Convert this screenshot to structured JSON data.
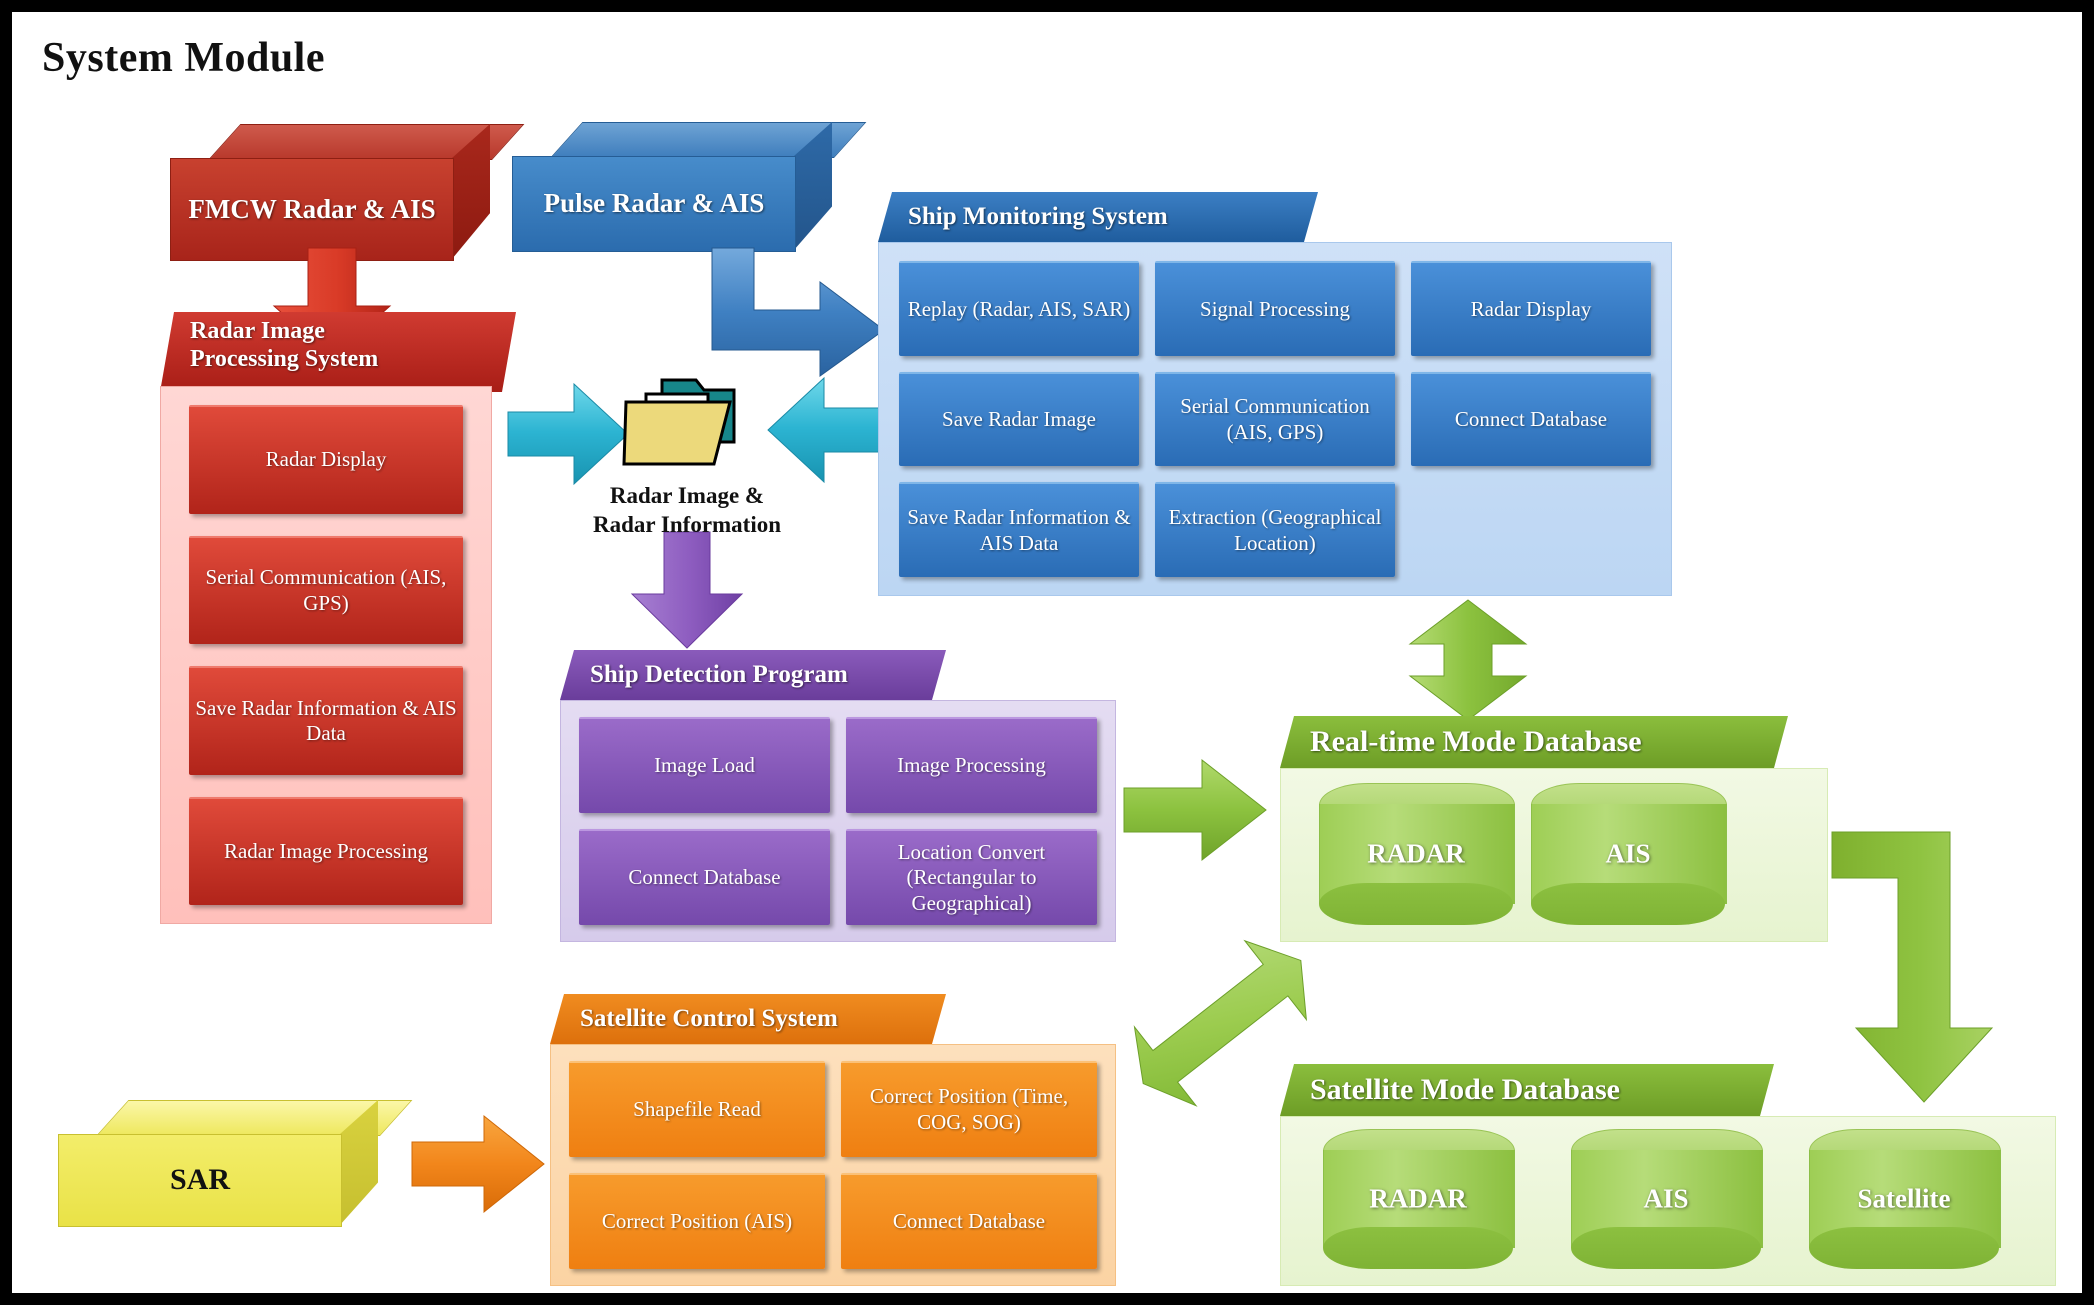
{
  "page": {
    "title": "System Module"
  },
  "sources": {
    "fmcw": {
      "label": "FMCW Radar & AIS",
      "color": "#c0392b"
    },
    "pulse": {
      "label": "Pulse Radar & AIS",
      "color": "#2e6da4"
    },
    "sar": {
      "label": "SAR",
      "color": "#e8e14a"
    }
  },
  "store": {
    "icon": "folder-icon",
    "caption_line1": "Radar Image &",
    "caption_line2": "Radar Information"
  },
  "panels": {
    "radar_image_processing": {
      "title": "Radar Image Processing System",
      "title_line1": "Radar Image",
      "title_line2": "Processing System",
      "color": "#b1241a",
      "items": [
        "Radar Display",
        "Serial Communication (AIS, GPS)",
        "Save Radar Information & AIS Data",
        "Radar Image Processing"
      ]
    },
    "ship_monitoring": {
      "title": "Ship Monitoring System",
      "color": "#2a6cb5",
      "items": [
        "Replay (Radar, AIS, SAR)",
        "Signal Processing",
        "Radar Display",
        "Save Radar Image",
        "Serial Communication (AIS, GPS)",
        "Connect Database",
        "Save Radar Information & AIS Data",
        "Extraction (Geographical Location)"
      ]
    },
    "ship_detection": {
      "title": "Ship Detection Program",
      "color": "#7549ab",
      "items": [
        "Image Load",
        "Image Processing",
        "Connect Database",
        "Location Convert (Rectangular to Geographical)"
      ]
    },
    "satellite_control": {
      "title": "Satellite Control System",
      "color": "#ef7f11",
      "items": [
        "Shapefile Read",
        "Correct Position (Time, COG, SOG)",
        "Correct Position (AIS)",
        "Connect Database"
      ]
    },
    "realtime_db": {
      "title": "Real-time  Mode Database",
      "color": "#6d9d26",
      "stores": [
        "RADAR",
        "AIS"
      ]
    },
    "satellite_db": {
      "title": "Satellite  Mode Database",
      "color": "#6d9d26",
      "stores": [
        "RADAR",
        "AIS",
        "Satellite"
      ]
    }
  },
  "arrows": {
    "fmcw_down": {
      "name": "red-down-arrow",
      "color": "#e03a2a"
    },
    "folder_in_left": {
      "name": "cyan-right-arrow",
      "color": "#2eb6d4"
    },
    "folder_in_right": {
      "name": "cyan-left-arrow",
      "color": "#2eb6d4"
    },
    "pulse_to_monitoring": {
      "name": "blue-elbow-right-arrow",
      "color": "#3d7fc0"
    },
    "folder_down": {
      "name": "purple-down-arrow",
      "color": "#9a6bc9"
    },
    "detection_to_rtdb": {
      "name": "green-right-arrow",
      "color": "#8cc23f"
    },
    "monitoring_rtdb": {
      "name": "green-updown-arrow",
      "color": "#8cc23f"
    },
    "detection_satdb": {
      "name": "green-diagonal-double-arrow",
      "color": "#8cc23f"
    },
    "rtdb_to_satdb": {
      "name": "green-elbow-down-arrow",
      "color": "#8cc23f"
    },
    "sar_to_satellite": {
      "name": "orange-right-arrow",
      "color": "#f2861b"
    }
  }
}
